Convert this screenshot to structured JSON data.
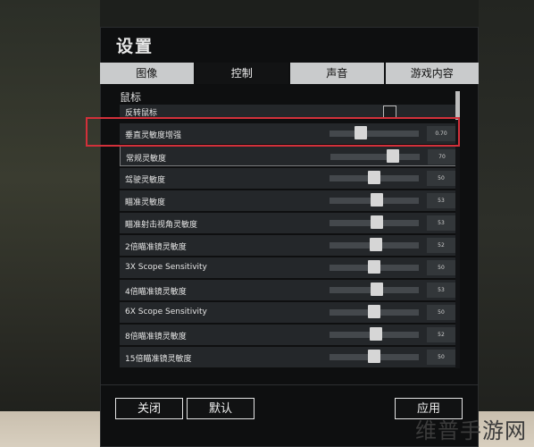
{
  "window": {
    "title": "设置"
  },
  "tabs": [
    {
      "label": "图像",
      "active": false
    },
    {
      "label": "控制",
      "active": true
    },
    {
      "label": "声音",
      "active": false
    },
    {
      "label": "游戏内容",
      "active": false
    }
  ],
  "mouse": {
    "section_label": "鼠标",
    "invert_label": "反转鼠标",
    "rows": [
      {
        "label": "垂直灵敏度增强",
        "value": "0.70",
        "level": 0.35
      },
      {
        "label": "常规灵敏度",
        "value": "70",
        "level": 0.7
      },
      {
        "label": "驾驶灵敏度",
        "value": "50",
        "level": 0.5
      },
      {
        "label": "瞄准灵敏度",
        "value": "53",
        "level": 0.53
      },
      {
        "label": "瞄准射击视角灵敏度",
        "value": "53",
        "level": 0.53
      },
      {
        "label": "2倍瞄准镜灵敏度",
        "value": "52",
        "level": 0.52
      },
      {
        "label": "3X Scope Sensitivity",
        "value": "50",
        "level": 0.5
      },
      {
        "label": "4倍瞄准镜灵敏度",
        "value": "53",
        "level": 0.53
      },
      {
        "label": "6X Scope Sensitivity",
        "value": "50",
        "level": 0.5
      },
      {
        "label": "8倍瞄准镜灵敏度",
        "value": "52",
        "level": 0.52
      },
      {
        "label": "15倍瞄准镜灵敏度",
        "value": "50",
        "level": 0.5
      }
    ]
  },
  "footer": {
    "close": "关闭",
    "default": "默认",
    "apply": "应用"
  },
  "watermark": "维普手游网",
  "colors": {
    "highlight": "#d2303a",
    "tab_inactive": "#c9cbcc",
    "panel": "#0e0f10"
  }
}
